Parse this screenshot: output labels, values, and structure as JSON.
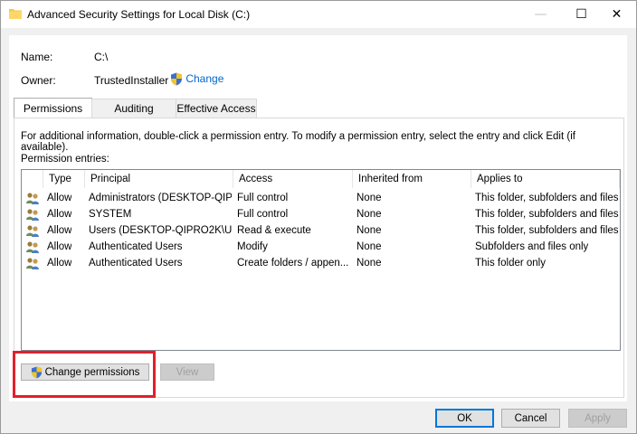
{
  "window": {
    "title": "Advanced Security Settings for Local Disk (C:)",
    "minimize_glyph": "—",
    "maximize_glyph": "☐",
    "close_glyph": "✕"
  },
  "info": {
    "name_label": "Name:",
    "name_value": "C:\\",
    "owner_label": "Owner:",
    "owner_value": "TrustedInstaller",
    "change_link": "Change"
  },
  "tabs": [
    {
      "label": "Permissions",
      "active": true
    },
    {
      "label": "Auditing",
      "active": false
    },
    {
      "label": "Effective Access",
      "active": false
    }
  ],
  "permissions": {
    "description": "For additional information, double-click a permission entry. To modify a permission entry, select the entry and click Edit (if available).",
    "entries_label": "Permission entries:",
    "columns": [
      "Type",
      "Principal",
      "Access",
      "Inherited from",
      "Applies to"
    ],
    "rows": [
      {
        "type": "Allow",
        "principal": "Administrators (DESKTOP-QIP...",
        "access": "Full control",
        "inherited": "None",
        "applies": "This folder, subfolders and files"
      },
      {
        "type": "Allow",
        "principal": "SYSTEM",
        "access": "Full control",
        "inherited": "None",
        "applies": "This folder, subfolders and files"
      },
      {
        "type": "Allow",
        "principal": "Users (DESKTOP-QIPRO2K\\Us...",
        "access": "Read & execute",
        "inherited": "None",
        "applies": "This folder, subfolders and files"
      },
      {
        "type": "Allow",
        "principal": "Authenticated Users",
        "access": "Modify",
        "inherited": "None",
        "applies": "Subfolders and files only"
      },
      {
        "type": "Allow",
        "principal": "Authenticated Users",
        "access": "Create folders / appen...",
        "inherited": "None",
        "applies": "This folder only"
      }
    ],
    "change_permissions_button": "Change permissions",
    "view_button": "View"
  },
  "footer": {
    "ok_button": "OK",
    "cancel_button": "Cancel",
    "apply_button": "Apply"
  },
  "colors": {
    "highlight": "#e0202a",
    "link": "#0066cc"
  }
}
